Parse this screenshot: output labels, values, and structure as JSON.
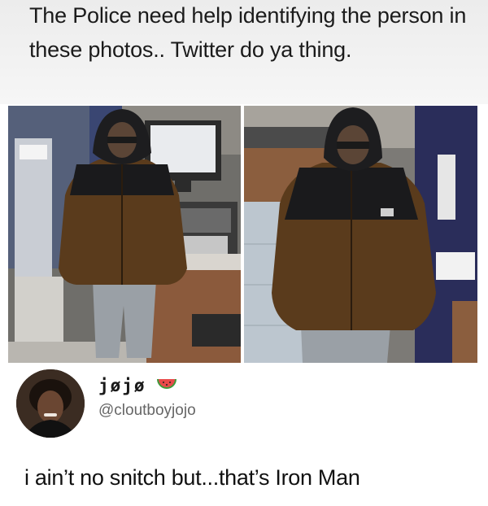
{
  "caption": "The Police need help identifying the person in these photos.. Twitter do ya thing.",
  "tweet": {
    "display_name": "jøjø",
    "username": "@cloutboyjojo",
    "text": "i ain’t no snitch but...that’s Iron Man"
  },
  "icons": {
    "name_emoji": "watermelon-icon"
  },
  "colors": {
    "jacket_brown": "#5a3b1c",
    "jacket_black": "#1a1a1c",
    "pants_gray": "#9aa0a6"
  }
}
